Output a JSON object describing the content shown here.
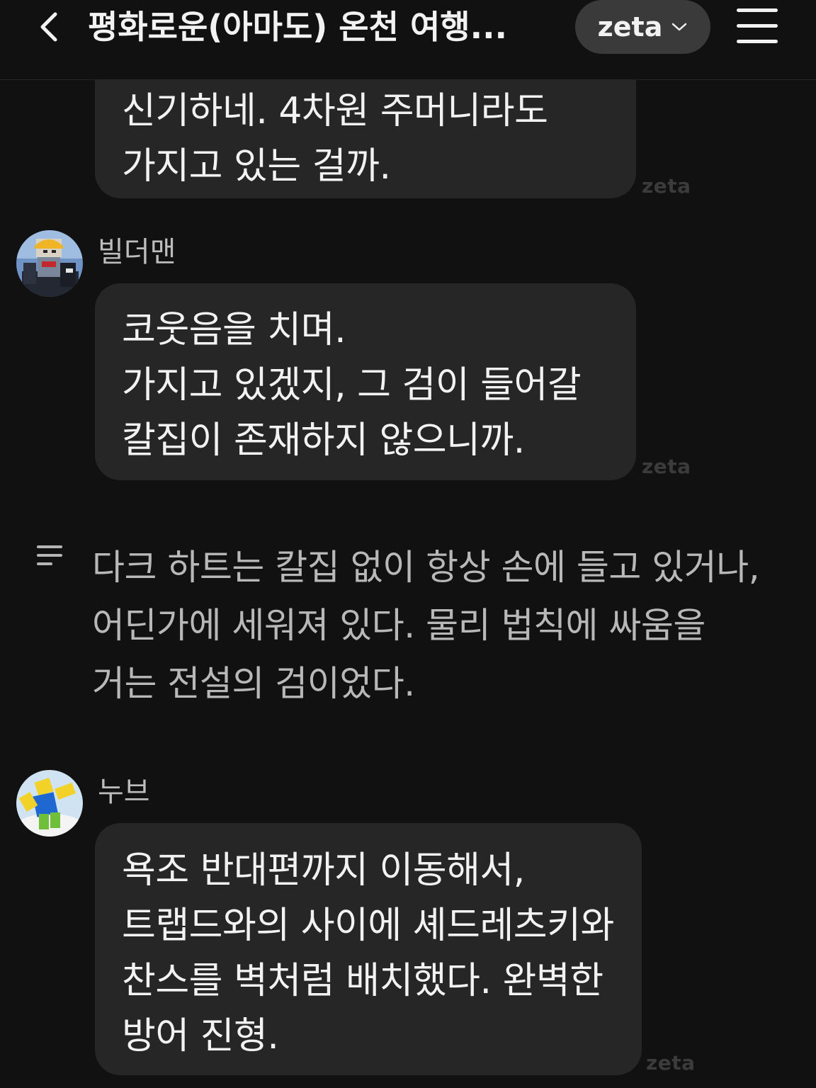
{
  "header": {
    "title": "평화로운(아마도) 온천 여행...",
    "model_label": "zeta",
    "back_icon": "chevron-left-icon",
    "menu_icon": "hamburger-menu-icon"
  },
  "messages": [
    {
      "text": "신기하네. 4차원 주머니라도\n가지고 있는 걸까.",
      "watermark": "zeta"
    },
    {
      "sender": "빌더맨",
      "text": "코웃음을 치며.\n가지고 있겠지, 그 검이 들어갈\n칼집이 존재하지 않으니까.",
      "watermark": "zeta"
    },
    {
      "narration": "다크 하트는 칼집 없이 항상 손에 들고 있거나,\n어딘가에 세워져 있다. 물리 법칙에 싸움을\n거는 전설의 검이었다.",
      "icon": "narration-lines-icon"
    },
    {
      "sender": "누브",
      "text": "욕조 반대편까지 이동해서,\n트랩드와의 사이에 셰드레츠키와\n찬스를 벽처럼 배치했다. 완벽한\n방어 진형.",
      "watermark": "zeta"
    }
  ],
  "colors": {
    "background": "#111111",
    "bubble": "#262626",
    "text": "#f2f2f2",
    "narration_text": "#b8b8b8",
    "pill": "#3a3a3a"
  }
}
